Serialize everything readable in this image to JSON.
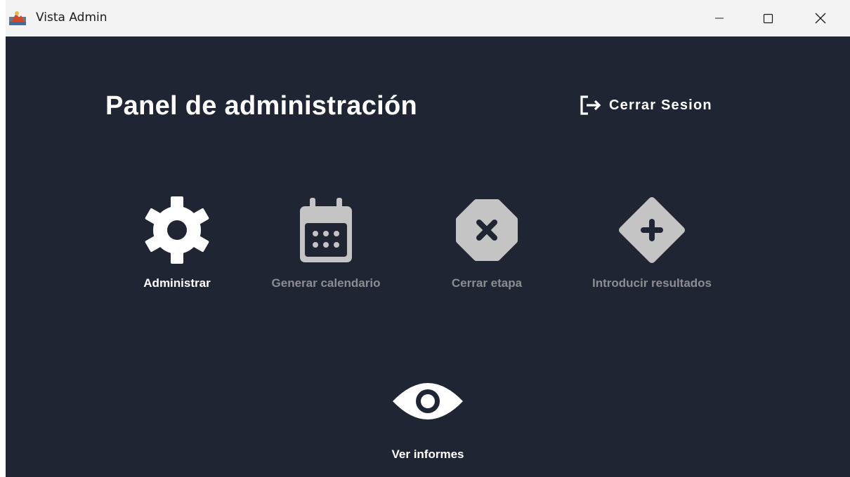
{
  "window": {
    "title": "Vista Admin",
    "icon": "java-app-icon",
    "controls": [
      "minimize-icon",
      "maximize-icon",
      "close-icon"
    ]
  },
  "header": {
    "title": "Panel de administración",
    "logout_label": "Cerrar Sesion",
    "logout_icon": "logout-icon"
  },
  "actions": [
    {
      "label": "Administrar",
      "icon": "gear-icon",
      "enabled": true
    },
    {
      "label": "Generar calendario",
      "icon": "calendar-icon",
      "enabled": false
    },
    {
      "label": "Cerrar etapa",
      "icon": "octagon-x-icon",
      "enabled": false
    },
    {
      "label": "Introducir resultados",
      "icon": "diamond-plus-icon",
      "enabled": false
    },
    {
      "label": "Ver informes",
      "icon": "eye-icon",
      "enabled": true
    }
  ],
  "colors": {
    "background": "#1f2533",
    "titlebar": "#f3f3f3",
    "active": "#ffffff",
    "disabled_icon": "#c4c4c4",
    "disabled_label": "#8a8d92"
  }
}
